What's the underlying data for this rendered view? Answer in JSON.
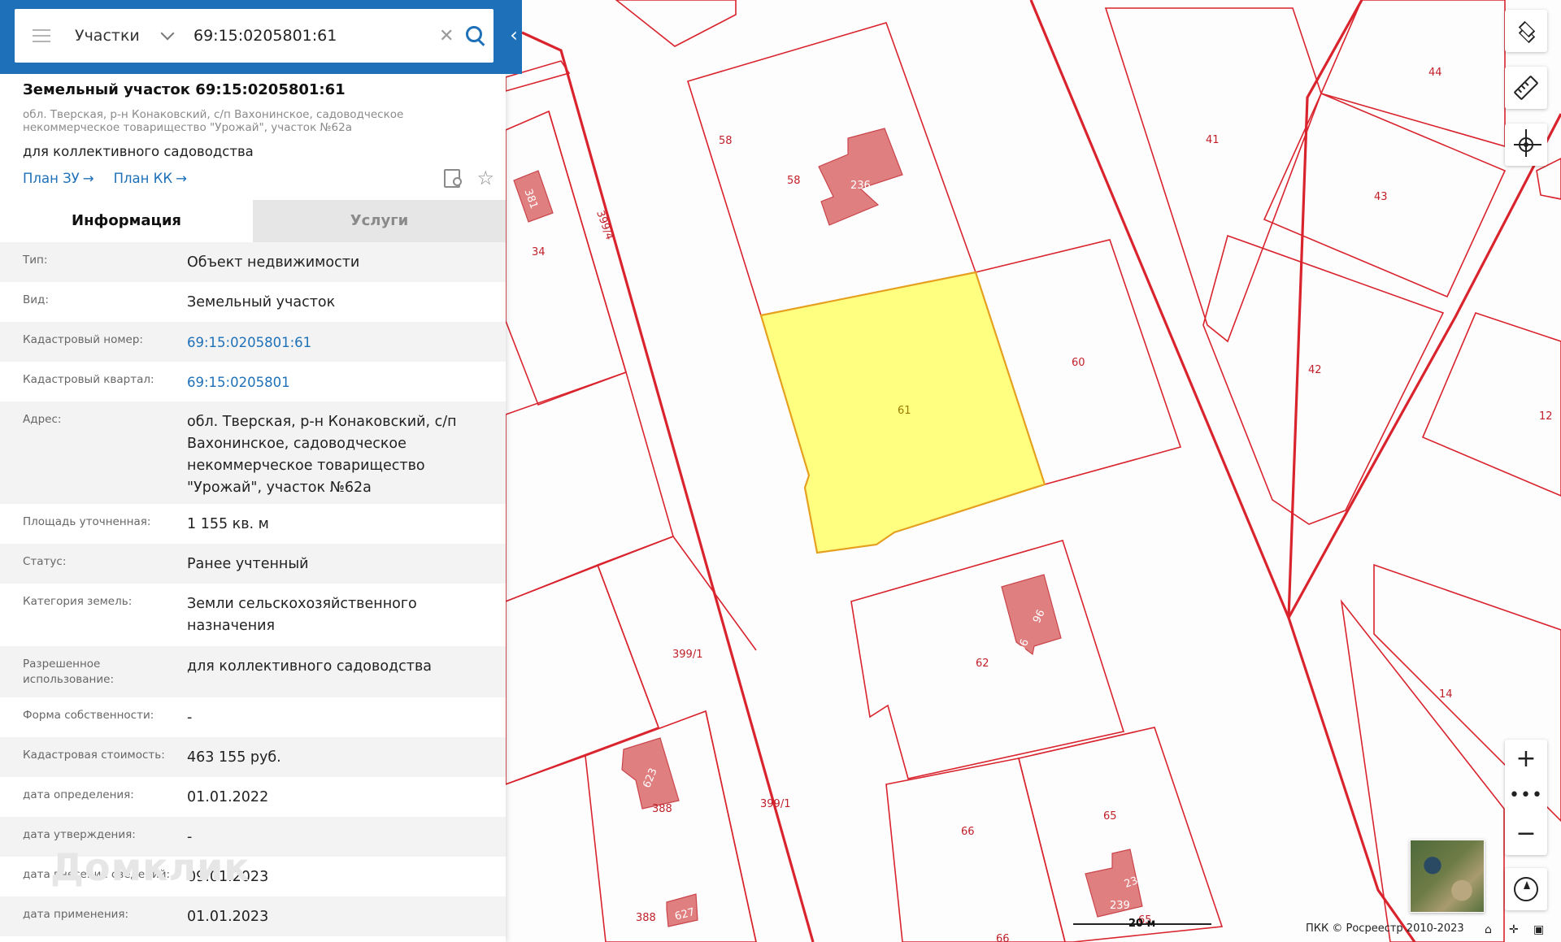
{
  "search": {
    "type_label": "Участки",
    "value": "69:15:0205801:61"
  },
  "object": {
    "title": "Земельный участок 69:15:0205801:61",
    "address_short": "обл. Тверская, р-н Конаковский, с/п Вахонинское, садоводческое некоммерческое товарищество \"Урожай\", участок №62а",
    "purpose": "для коллективного садоводства",
    "links": [
      "План ЗУ",
      "План КК"
    ]
  },
  "tabs": [
    {
      "label": "Информация",
      "active": true
    },
    {
      "label": "Услуги",
      "active": false
    }
  ],
  "info_rows": [
    {
      "key": "Тип:",
      "value": "Объект недвижимости"
    },
    {
      "key": "Вид:",
      "value": "Земельный участок"
    },
    {
      "key": "Кадастровый номер:",
      "value": "69:15:0205801:61",
      "link": true
    },
    {
      "key": "Кадастровый квартал:",
      "value": "69:15:0205801",
      "link": true
    },
    {
      "key": "Адрес:",
      "value": "обл. Тверская, р-н Конаковский, с/п Вахонинское, садоводческое некоммерческое товарищество \"Урожай\", участок №62а"
    },
    {
      "key": "Площадь уточненная:",
      "value": "1 155 кв. м"
    },
    {
      "key": "Статус:",
      "value": "Ранее учтенный"
    },
    {
      "key": "Категория земель:",
      "value": "Земли сельскохозяйственного назначения"
    },
    {
      "key": "Разрешенное использование:",
      "value": "для коллективного садоводства"
    },
    {
      "key": "Форма собственности:",
      "value": "-"
    },
    {
      "key": "Кадастровая стоимость:",
      "value": "463 155 руб."
    },
    {
      "key": "дата определения:",
      "value": "01.01.2022"
    },
    {
      "key": "дата утверждения:",
      "value": "-"
    },
    {
      "key": "дата внесения сведений:",
      "value": "09.01.2023"
    },
    {
      "key": "дата применения:",
      "value": "01.01.2023"
    }
  ],
  "watermark": "Домклик",
  "map": {
    "plot_labels": [
      "58",
      "58",
      "381",
      "34",
      "399/4",
      "41",
      "44",
      "43",
      "42",
      "12",
      "60",
      "61",
      "62",
      "96",
      "96",
      "399/1",
      "399/1",
      "388",
      "388",
      "623",
      "627",
      "66",
      "65",
      "66",
      "65",
      "239",
      "239",
      "14",
      "236"
    ],
    "scale_label": "20 м",
    "copyright": "ПКК © Росреестр 2010-2023"
  },
  "colors": {
    "header_blue": "#1e71b8",
    "plot_outline": "#d9232d",
    "building_fill": "#e07f80",
    "selected_fill": "#ffff80"
  }
}
